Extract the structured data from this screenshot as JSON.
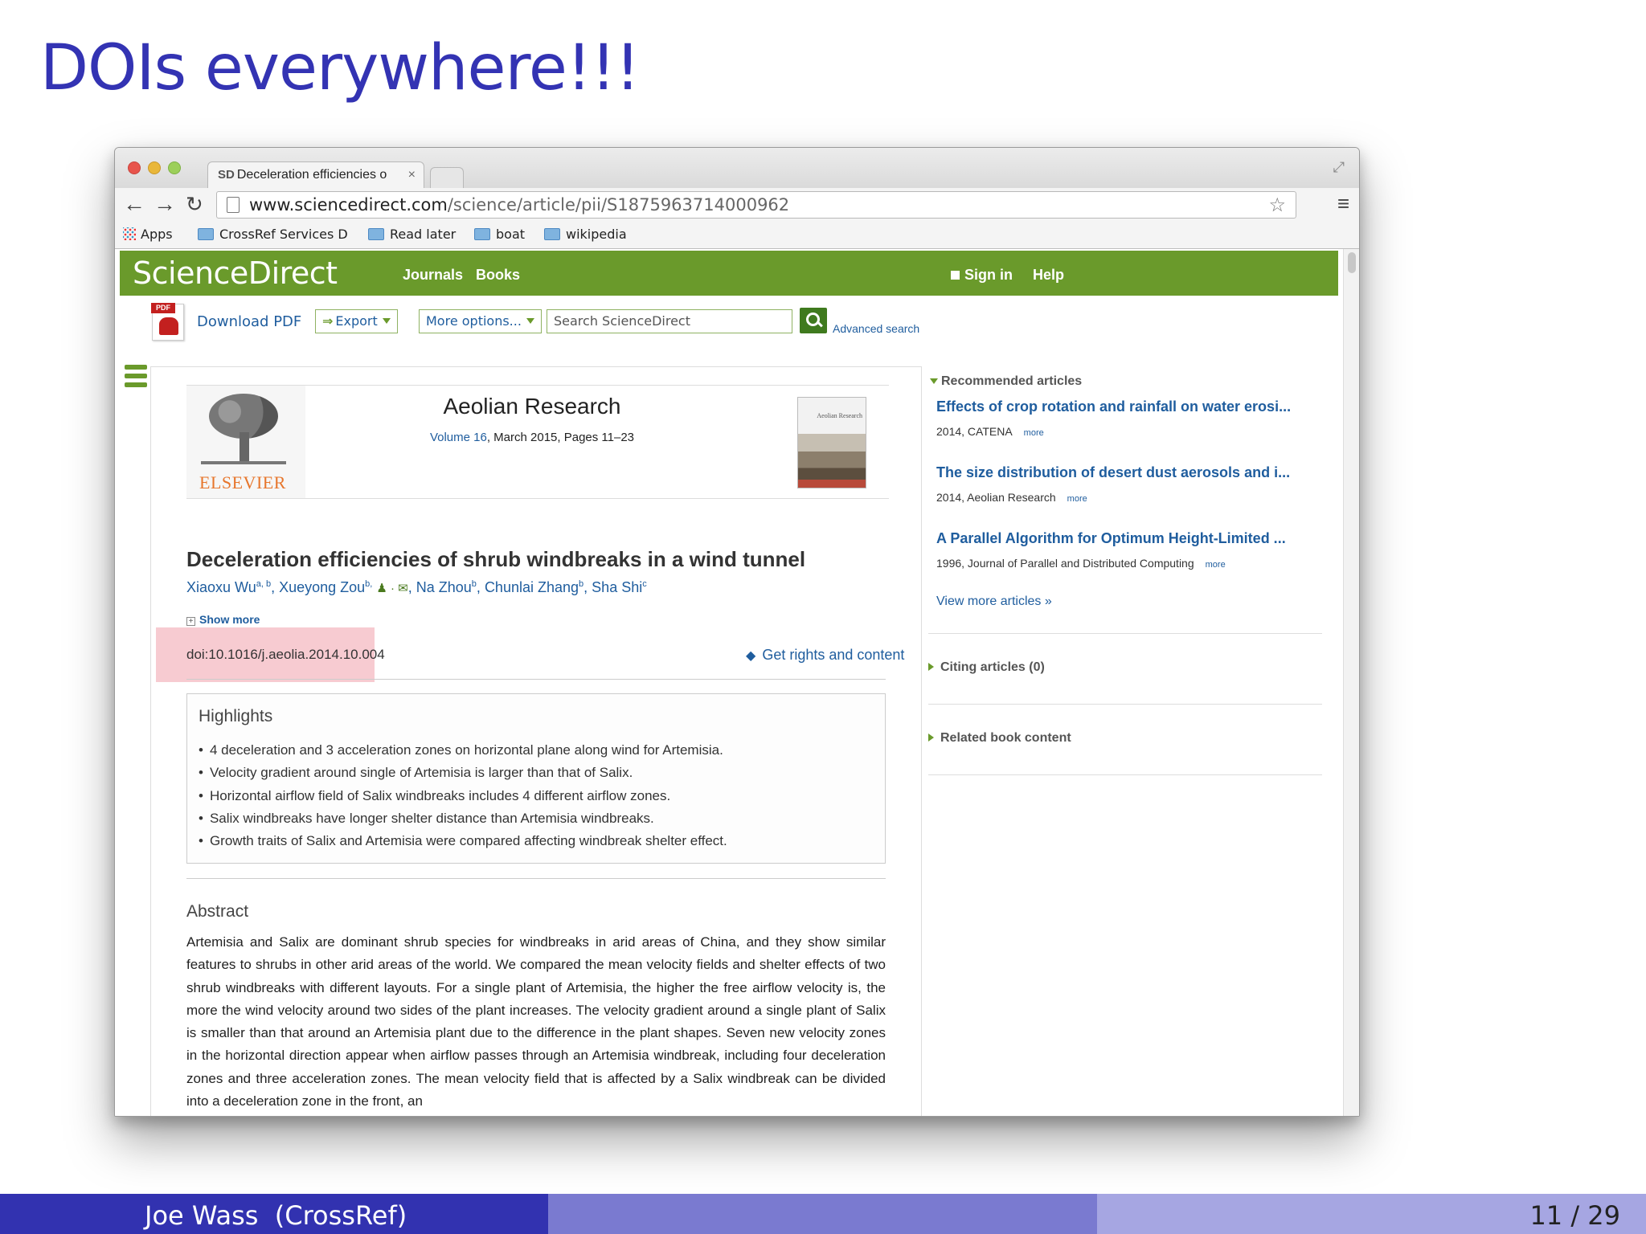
{
  "slide": {
    "title": "DOIs everywhere!!!",
    "footer_author": "Joe Wass  (CrossRef)",
    "footer_page": "11 / 29"
  },
  "browser": {
    "tab_title": "Deceleration efficiencies o",
    "tab_favicon": "SD",
    "tab_close": "×",
    "url_domain": "www.sciencedirect.com",
    "url_path": "/science/article/pii/S1875963714000962",
    "bookmarks": {
      "apps": "Apps",
      "crossref": "CrossRef Services D",
      "read_later": "Read later",
      "boat": "boat",
      "wikipedia": "wikipedia"
    }
  },
  "site": {
    "logo": "ScienceDirect",
    "nav_journals": "Journals",
    "nav_books": "Books",
    "signin": "Sign in",
    "help": "Help",
    "download_pdf": "Download PDF",
    "export": "Export",
    "more_options": "More options...",
    "search_placeholder": "Search ScienceDirect",
    "advanced_search": "Advanced search"
  },
  "journal": {
    "publisher": "ELSEVIER",
    "name": "Aeolian Research",
    "volume": "Volume 16",
    "details": ", March 2015, Pages 11–23",
    "cover_title": "Aeolian Research"
  },
  "article": {
    "title": "Deceleration efficiencies of shrub windbreaks in a wind tunnel",
    "authors": [
      {
        "name": "Xiaoxu Wu",
        "sup": "a, b"
      },
      {
        "name": "Xueyong Zou",
        "sup": "b,"
      },
      {
        "name": "Na Zhou",
        "sup": "b"
      },
      {
        "name": "Chunlai Zhang",
        "sup": "b"
      },
      {
        "name": "Sha Shi",
        "sup": "c"
      }
    ],
    "show_more": "Show more",
    "doi": "doi:10.1016/j.aeolia.2014.10.004",
    "rights": "Get rights and content",
    "highlights_title": "Highlights",
    "highlights": [
      "4 deceleration and 3 acceleration zones on horizontal plane along wind for Artemisia.",
      "Velocity gradient around single of Artemisia is larger than that of Salix.",
      "Horizontal airflow field of Salix windbreaks includes 4 different airflow zones.",
      "Salix windbreaks have longer shelter distance than Artemisia windbreaks.",
      "Growth traits of Salix and Artemisia were compared affecting windbreak shelter effect."
    ],
    "abstract_title": "Abstract",
    "abstract": "Artemisia and Salix are dominant shrub species for windbreaks in arid areas of China, and they show similar features to shrubs in other arid areas of the world. We compared the mean velocity fields and shelter effects of two shrub windbreaks with different layouts. For a single plant of Artemisia, the higher the free airflow velocity is, the more the wind velocity around two sides of the plant increases. The velocity gradient around a single plant of Salix is smaller than that around an Artemisia plant due to the difference in the plant shapes. Seven new velocity zones in the horizontal direction appear when airflow passes through an Artemisia windbreak, including four deceleration zones and three acceleration zones. The mean velocity field that is affected by a Salix windbreak can be divided into a deceleration zone in the front, an"
  },
  "sidebar": {
    "recommended_title": "Recommended articles",
    "recommended": [
      {
        "title": "Effects of crop rotation and rainfall on water erosi...",
        "meta": "2014, CATENA",
        "more": "more"
      },
      {
        "title": "The size distribution of desert dust aerosols and i...",
        "meta": "2014, Aeolian Research",
        "more": "more"
      },
      {
        "title": "A Parallel Algorithm for Optimum Height-Limited ...",
        "meta": "1996, Journal of Parallel and Distributed Computing",
        "more": "more"
      }
    ],
    "view_more": "View more articles »",
    "citing": "Citing articles (0)",
    "related": "Related book content"
  }
}
